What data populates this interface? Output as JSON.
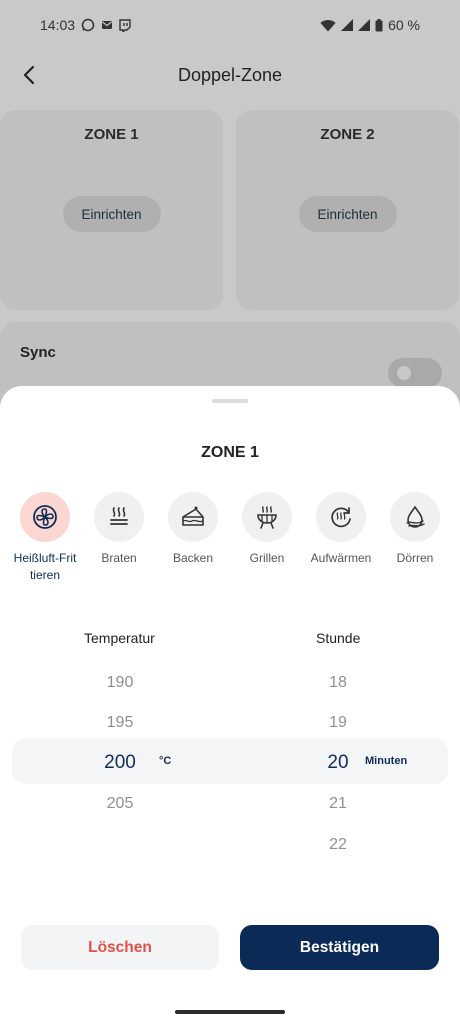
{
  "status_bar": {
    "time": "14:03",
    "battery": "60 %"
  },
  "header": {
    "title": "Doppel-Zone"
  },
  "zones": [
    {
      "title": "ZONE 1",
      "button_label": "Einrichten"
    },
    {
      "title": "ZONE 2",
      "button_label": "Einrichten"
    }
  ],
  "sync": {
    "label": "Sync",
    "enabled": false
  },
  "sheet": {
    "title": "ZONE 1",
    "modes": [
      {
        "label": "Heißluft-Frit\ntieren",
        "icon": "fan-icon",
        "active": true
      },
      {
        "label": "Braten",
        "icon": "roast-icon",
        "active": false
      },
      {
        "label": "Backen",
        "icon": "cake-icon",
        "active": false
      },
      {
        "label": "Grillen",
        "icon": "grill-icon",
        "active": false
      },
      {
        "label": "Aufwärmen",
        "icon": "reheat-icon",
        "active": false
      },
      {
        "label": "Dörren",
        "icon": "dehydrate-icon",
        "active": false
      }
    ],
    "temperature": {
      "header": "Temperatur",
      "values": [
        "190",
        "195",
        "200",
        "205"
      ],
      "selected": "200",
      "unit": "°C"
    },
    "time": {
      "header": "Stunde",
      "values": [
        "18",
        "19",
        "20",
        "21",
        "22"
      ],
      "selected": "20",
      "unit": "Minuten"
    },
    "delete_label": "Löschen",
    "confirm_label": "Bestätigen"
  },
  "colors": {
    "accent": "#0b2a55",
    "danger": "#e3504a",
    "active_mode_bg": "#fcd7d1"
  }
}
